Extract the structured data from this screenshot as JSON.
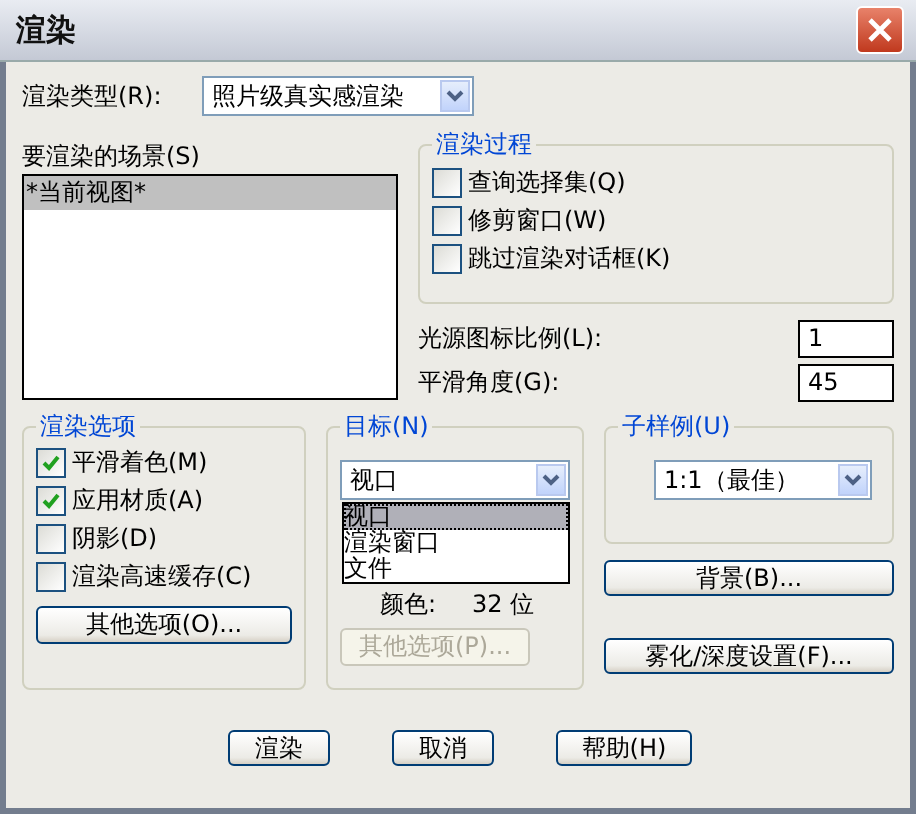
{
  "window": {
    "title": "渲染"
  },
  "render_type": {
    "label": "渲染类型(R):",
    "value": "照片级真实感渲染"
  },
  "scenes": {
    "label": "要渲染的场景(S)",
    "items": [
      {
        "label": "*当前视图*",
        "selected": true
      }
    ]
  },
  "render_process": {
    "title": "渲染过程",
    "options": [
      {
        "label": "查询选择集(Q)",
        "checked": false
      },
      {
        "label": "修剪窗口(W)",
        "checked": false
      },
      {
        "label": "跳过渲染对话框(K)",
        "checked": false
      }
    ]
  },
  "light_icon_scale": {
    "label": "光源图标比例(L):",
    "value": "1"
  },
  "smoothing_angle": {
    "label": "平滑角度(G):",
    "value": "45"
  },
  "render_options": {
    "title": "渲染选项",
    "options": [
      {
        "label": "平滑着色(M)",
        "checked": true
      },
      {
        "label": "应用材质(A)",
        "checked": true
      },
      {
        "label": "阴影(D)",
        "checked": false
      },
      {
        "label": "渲染高速缓存(C)",
        "checked": false
      }
    ],
    "button": "其他选项(O)..."
  },
  "destination": {
    "title": "目标(N)",
    "value": "视口",
    "dropdown": [
      {
        "label": "视口",
        "selected": true
      },
      {
        "label": "渲染窗口",
        "selected": false
      },
      {
        "label": "文件",
        "selected": false
      }
    ],
    "color_label": "颜色:",
    "color_value": "32 位",
    "button": {
      "label": "其他选项(P)...",
      "disabled": true
    }
  },
  "sub_sampling": {
    "title": "子样例(U)",
    "value": "1:1（最佳）"
  },
  "background_button": "背景(B)...",
  "fog_button": "雾化/深度设置(F)...",
  "buttons": [
    "渲染",
    "取消",
    "帮助(H)"
  ]
}
